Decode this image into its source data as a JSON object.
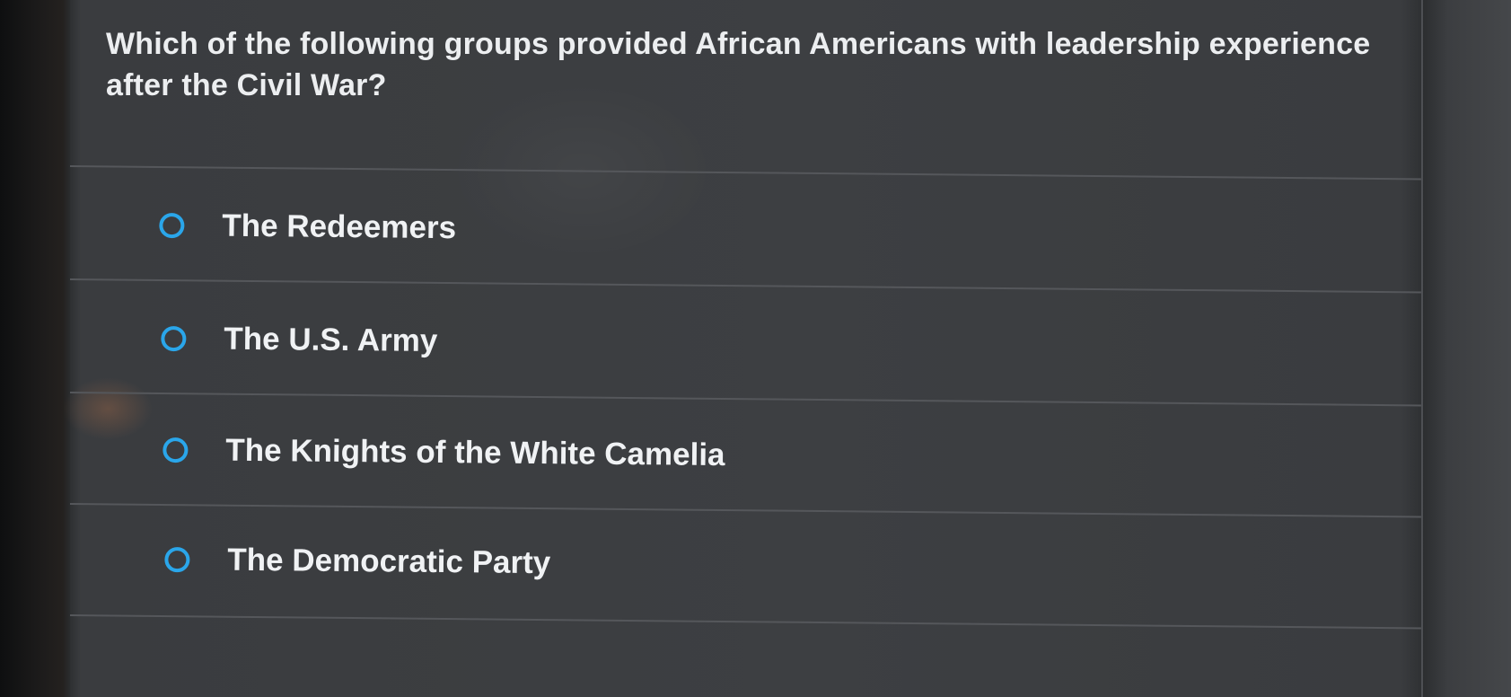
{
  "question": {
    "text": "Which of the following groups provided African Americans with leadership experience after the Civil War?"
  },
  "options": [
    {
      "label": "The Redeemers",
      "selected": false
    },
    {
      "label": "The U.S. Army",
      "selected": false
    },
    {
      "label": "The Knights of the White Camelia",
      "selected": false
    },
    {
      "label": "The Democratic Party",
      "selected": false
    }
  ],
  "colors": {
    "radio_accent": "#2aa6ea",
    "text": "#eceef0",
    "panel_background": "#3d3f42"
  }
}
